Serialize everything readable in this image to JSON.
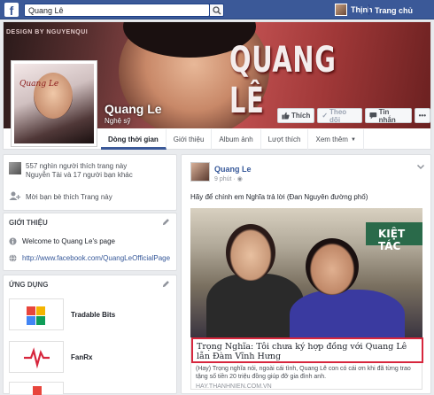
{
  "topbar": {
    "logo": "f",
    "search_value": "Quang Lê",
    "user_name": "Thịnh",
    "home_label": "Trang chủ"
  },
  "cover": {
    "credit": "DESIGN BY NGUYENQUI",
    "title": "QUANG LÊ",
    "profile_text": "Quang Le"
  },
  "profile": {
    "name": "Quang Le",
    "category": "Nghệ sỹ"
  },
  "cover_buttons": {
    "like": "Thích",
    "follow": "Theo dõi",
    "message": "Tin nhắn"
  },
  "nav": {
    "tabs": [
      "Dòng thời gian",
      "Giới thiệu",
      "Album ảnh",
      "Lượt thích",
      "Xem thêm"
    ]
  },
  "stats": {
    "likes": "557 nghìn người thích trang này",
    "likes_sub": "Nguyễn Tài và 17 người bạn khác",
    "invite": "Mời bạn bè thích Trang này"
  },
  "about": {
    "heading": "GIỚI THIỆU",
    "welcome": "Welcome to Quang Le's page",
    "url": "http://www.facebook.com/QuangLeOfficialPage"
  },
  "apps": {
    "heading": "ỨNG DỤNG",
    "items": [
      "Tradable Bits",
      "FanRx"
    ]
  },
  "post": {
    "author": "Quang Le",
    "time": "9 phút ·",
    "text": "Hãy để chính em Nghĩa trả lời (Đan Nguyên đường phố)",
    "photo_sign": "KIỆT TÁC",
    "link_title": "Trọng Nghĩa: Tôi chưa ký hợp đồng với Quang Lê lẫn Đàm Vĩnh Hưng",
    "link_desc": "(Hay) Trọng nghĩa nói, ngoài cái tình, Quang Lê con có cái ơn khi đã từng trao tặng số tiền 20 triệu đồng giúp đỡ gia đình anh.",
    "link_url": "HAY.THANHNIEN.COM.VN"
  },
  "colors": {
    "brand": "#3b5998",
    "link": "#365899",
    "highlight_box": "#d7263d"
  }
}
